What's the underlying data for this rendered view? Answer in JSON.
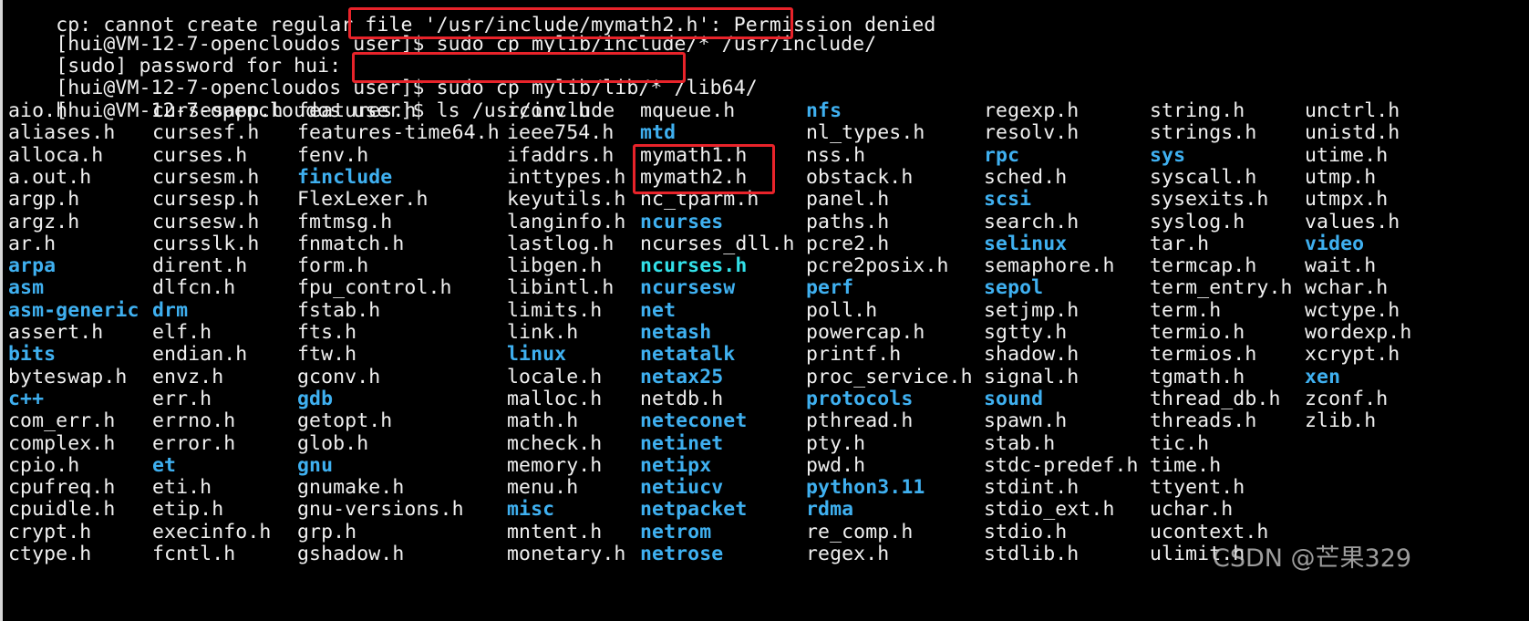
{
  "terminal": {
    "lines": [
      {
        "prompt": "",
        "text": "cp: cannot create regular file '/usr/include/mymath2.h': Permission denied"
      },
      {
        "prompt": "[hui@VM-12-7-opencloudos user]$ ",
        "text": "sudo cp mylib/include/* /usr/include/"
      },
      {
        "prompt": "",
        "text": "[sudo] password for hui:"
      },
      {
        "prompt": "[hui@VM-12-7-opencloudos user]$ ",
        "text": "sudo cp mylib/lib/* /lib64/"
      },
      {
        "prompt": "[hui@VM-12-7-opencloudos user]$ ",
        "text": "ls /usr/include"
      }
    ],
    "colors": {
      "background": "#000000",
      "text": "#f0f0f0",
      "directory": "#3fb0f0",
      "symlink": "#33e0e8",
      "highlight_box": "#e8232a"
    },
    "listing_columns": [
      [
        {
          "name": "aio.h",
          "type": "file"
        },
        {
          "name": "aliases.h",
          "type": "file"
        },
        {
          "name": "alloca.h",
          "type": "file"
        },
        {
          "name": "a.out.h",
          "type": "file"
        },
        {
          "name": "argp.h",
          "type": "file"
        },
        {
          "name": "argz.h",
          "type": "file"
        },
        {
          "name": "ar.h",
          "type": "file"
        },
        {
          "name": "arpa",
          "type": "dir"
        },
        {
          "name": "asm",
          "type": "dir"
        },
        {
          "name": "asm-generic",
          "type": "dir"
        },
        {
          "name": "assert.h",
          "type": "file"
        },
        {
          "name": "bits",
          "type": "dir"
        },
        {
          "name": "byteswap.h",
          "type": "file"
        },
        {
          "name": "c++",
          "type": "dir"
        },
        {
          "name": "com_err.h",
          "type": "file"
        },
        {
          "name": "complex.h",
          "type": "file"
        },
        {
          "name": "cpio.h",
          "type": "file"
        },
        {
          "name": "cpufreq.h",
          "type": "file"
        },
        {
          "name": "cpuidle.h",
          "type": "file"
        },
        {
          "name": "crypt.h",
          "type": "file"
        },
        {
          "name": "ctype.h",
          "type": "file"
        }
      ],
      [
        {
          "name": "cursesapp.h",
          "type": "file"
        },
        {
          "name": "cursesf.h",
          "type": "file"
        },
        {
          "name": "curses.h",
          "type": "file"
        },
        {
          "name": "cursesm.h",
          "type": "file"
        },
        {
          "name": "cursesp.h",
          "type": "file"
        },
        {
          "name": "cursesw.h",
          "type": "file"
        },
        {
          "name": "cursslk.h",
          "type": "file"
        },
        {
          "name": "dirent.h",
          "type": "file"
        },
        {
          "name": "dlfcn.h",
          "type": "file"
        },
        {
          "name": "drm",
          "type": "dir"
        },
        {
          "name": "elf.h",
          "type": "file"
        },
        {
          "name": "endian.h",
          "type": "file"
        },
        {
          "name": "envz.h",
          "type": "file"
        },
        {
          "name": "err.h",
          "type": "file"
        },
        {
          "name": "errno.h",
          "type": "file"
        },
        {
          "name": "error.h",
          "type": "file"
        },
        {
          "name": "et",
          "type": "dir"
        },
        {
          "name": "eti.h",
          "type": "file"
        },
        {
          "name": "etip.h",
          "type": "file"
        },
        {
          "name": "execinfo.h",
          "type": "file"
        },
        {
          "name": "fcntl.h",
          "type": "file"
        }
      ],
      [
        {
          "name": "features.h",
          "type": "file"
        },
        {
          "name": "features-time64.h",
          "type": "file"
        },
        {
          "name": "fenv.h",
          "type": "file"
        },
        {
          "name": "finclude",
          "type": "dir"
        },
        {
          "name": "FlexLexer.h",
          "type": "file"
        },
        {
          "name": "fmtmsg.h",
          "type": "file"
        },
        {
          "name": "fnmatch.h",
          "type": "file"
        },
        {
          "name": "form.h",
          "type": "file"
        },
        {
          "name": "fpu_control.h",
          "type": "file"
        },
        {
          "name": "fstab.h",
          "type": "file"
        },
        {
          "name": "fts.h",
          "type": "file"
        },
        {
          "name": "ftw.h",
          "type": "file"
        },
        {
          "name": "gconv.h",
          "type": "file"
        },
        {
          "name": "gdb",
          "type": "dir"
        },
        {
          "name": "getopt.h",
          "type": "file"
        },
        {
          "name": "glob.h",
          "type": "file"
        },
        {
          "name": "gnu",
          "type": "dir"
        },
        {
          "name": "gnumake.h",
          "type": "file"
        },
        {
          "name": "gnu-versions.h",
          "type": "file"
        },
        {
          "name": "grp.h",
          "type": "file"
        },
        {
          "name": "gshadow.h",
          "type": "file"
        }
      ],
      [
        {
          "name": "iconv.h",
          "type": "file"
        },
        {
          "name": "ieee754.h",
          "type": "file"
        },
        {
          "name": "ifaddrs.h",
          "type": "file"
        },
        {
          "name": "inttypes.h",
          "type": "file"
        },
        {
          "name": "keyutils.h",
          "type": "file"
        },
        {
          "name": "langinfo.h",
          "type": "file"
        },
        {
          "name": "lastlog.h",
          "type": "file"
        },
        {
          "name": "libgen.h",
          "type": "file"
        },
        {
          "name": "libintl.h",
          "type": "file"
        },
        {
          "name": "limits.h",
          "type": "file"
        },
        {
          "name": "link.h",
          "type": "file"
        },
        {
          "name": "linux",
          "type": "dir"
        },
        {
          "name": "locale.h",
          "type": "file"
        },
        {
          "name": "malloc.h",
          "type": "file"
        },
        {
          "name": "math.h",
          "type": "file"
        },
        {
          "name": "mcheck.h",
          "type": "file"
        },
        {
          "name": "memory.h",
          "type": "file"
        },
        {
          "name": "menu.h",
          "type": "file"
        },
        {
          "name": "misc",
          "type": "dir"
        },
        {
          "name": "mntent.h",
          "type": "file"
        },
        {
          "name": "monetary.h",
          "type": "file"
        }
      ],
      [
        {
          "name": "mqueue.h",
          "type": "file"
        },
        {
          "name": "mtd",
          "type": "dir"
        },
        {
          "name": "mymath1.h",
          "type": "file"
        },
        {
          "name": "mymath2.h",
          "type": "file"
        },
        {
          "name": "nc_tparm.h",
          "type": "file"
        },
        {
          "name": "ncurses",
          "type": "dir"
        },
        {
          "name": "ncurses_dll.h",
          "type": "file"
        },
        {
          "name": "ncurses.h",
          "type": "link"
        },
        {
          "name": "ncursesw",
          "type": "dir"
        },
        {
          "name": "net",
          "type": "dir"
        },
        {
          "name": "netash",
          "type": "dir"
        },
        {
          "name": "netatalk",
          "type": "dir"
        },
        {
          "name": "netax25",
          "type": "dir"
        },
        {
          "name": "netdb.h",
          "type": "file"
        },
        {
          "name": "neteconet",
          "type": "dir"
        },
        {
          "name": "netinet",
          "type": "dir"
        },
        {
          "name": "netipx",
          "type": "dir"
        },
        {
          "name": "netiucv",
          "type": "dir"
        },
        {
          "name": "netpacket",
          "type": "dir"
        },
        {
          "name": "netrom",
          "type": "dir"
        },
        {
          "name": "netrose",
          "type": "dir"
        }
      ],
      [
        {
          "name": "nfs",
          "type": "dir"
        },
        {
          "name": "nl_types.h",
          "type": "file"
        },
        {
          "name": "nss.h",
          "type": "file"
        },
        {
          "name": "obstack.h",
          "type": "file"
        },
        {
          "name": "panel.h",
          "type": "file"
        },
        {
          "name": "paths.h",
          "type": "file"
        },
        {
          "name": "pcre2.h",
          "type": "file"
        },
        {
          "name": "pcre2posix.h",
          "type": "file"
        },
        {
          "name": "perf",
          "type": "dir"
        },
        {
          "name": "poll.h",
          "type": "file"
        },
        {
          "name": "powercap.h",
          "type": "file"
        },
        {
          "name": "printf.h",
          "type": "file"
        },
        {
          "name": "proc_service.h",
          "type": "file"
        },
        {
          "name": "protocols",
          "type": "dir"
        },
        {
          "name": "pthread.h",
          "type": "file"
        },
        {
          "name": "pty.h",
          "type": "file"
        },
        {
          "name": "pwd.h",
          "type": "file"
        },
        {
          "name": "python3.11",
          "type": "dir"
        },
        {
          "name": "rdma",
          "type": "dir"
        },
        {
          "name": "re_comp.h",
          "type": "file"
        },
        {
          "name": "regex.h",
          "type": "file"
        }
      ],
      [
        {
          "name": "regexp.h",
          "type": "file"
        },
        {
          "name": "resolv.h",
          "type": "file"
        },
        {
          "name": "rpc",
          "type": "dir"
        },
        {
          "name": "sched.h",
          "type": "file"
        },
        {
          "name": "scsi",
          "type": "dir"
        },
        {
          "name": "search.h",
          "type": "file"
        },
        {
          "name": "selinux",
          "type": "dir"
        },
        {
          "name": "semaphore.h",
          "type": "file"
        },
        {
          "name": "sepol",
          "type": "dir"
        },
        {
          "name": "setjmp.h",
          "type": "file"
        },
        {
          "name": "sgtty.h",
          "type": "file"
        },
        {
          "name": "shadow.h",
          "type": "file"
        },
        {
          "name": "signal.h",
          "type": "file"
        },
        {
          "name": "sound",
          "type": "dir"
        },
        {
          "name": "spawn.h",
          "type": "file"
        },
        {
          "name": "stab.h",
          "type": "file"
        },
        {
          "name": "stdc-predef.h",
          "type": "file"
        },
        {
          "name": "stdint.h",
          "type": "file"
        },
        {
          "name": "stdio_ext.h",
          "type": "file"
        },
        {
          "name": "stdio.h",
          "type": "file"
        },
        {
          "name": "stdlib.h",
          "type": "file"
        }
      ],
      [
        {
          "name": "string.h",
          "type": "file"
        },
        {
          "name": "strings.h",
          "type": "file"
        },
        {
          "name": "sys",
          "type": "dir"
        },
        {
          "name": "syscall.h",
          "type": "file"
        },
        {
          "name": "sysexits.h",
          "type": "file"
        },
        {
          "name": "syslog.h",
          "type": "file"
        },
        {
          "name": "tar.h",
          "type": "file"
        },
        {
          "name": "termcap.h",
          "type": "file"
        },
        {
          "name": "term_entry.h",
          "type": "file"
        },
        {
          "name": "term.h",
          "type": "file"
        },
        {
          "name": "termio.h",
          "type": "file"
        },
        {
          "name": "termios.h",
          "type": "file"
        },
        {
          "name": "tgmath.h",
          "type": "file"
        },
        {
          "name": "thread_db.h",
          "type": "file"
        },
        {
          "name": "threads.h",
          "type": "file"
        },
        {
          "name": "tic.h",
          "type": "file"
        },
        {
          "name": "time.h",
          "type": "file"
        },
        {
          "name": "ttyent.h",
          "type": "file"
        },
        {
          "name": "uchar.h",
          "type": "file"
        },
        {
          "name": "ucontext.h",
          "type": "file"
        },
        {
          "name": "ulimit.h",
          "type": "file"
        }
      ],
      [
        {
          "name": "unctrl.h",
          "type": "file"
        },
        {
          "name": "unistd.h",
          "type": "file"
        },
        {
          "name": "utime.h",
          "type": "file"
        },
        {
          "name": "utmp.h",
          "type": "file"
        },
        {
          "name": "utmpx.h",
          "type": "file"
        },
        {
          "name": "values.h",
          "type": "file"
        },
        {
          "name": "video",
          "type": "dir"
        },
        {
          "name": "wait.h",
          "type": "file"
        },
        {
          "name": "wchar.h",
          "type": "file"
        },
        {
          "name": "wctype.h",
          "type": "file"
        },
        {
          "name": "wordexp.h",
          "type": "file"
        },
        {
          "name": "xcrypt.h",
          "type": "file"
        },
        {
          "name": "xen",
          "type": "dir"
        },
        {
          "name": "zconf.h",
          "type": "file"
        },
        {
          "name": "zlib.h",
          "type": "file"
        }
      ]
    ]
  },
  "annotations": {
    "highlights": [
      {
        "label": "sudo cp mylib/include/* /usr/include/",
        "target": "command-line-2"
      },
      {
        "label": "sudo cp mylib/lib/* /lib64/",
        "target": "command-line-4"
      },
      {
        "label": "mymath1.h / mymath2.h",
        "target": "listing mymath headers"
      }
    ]
  },
  "watermark": "CSDN @芒果329"
}
